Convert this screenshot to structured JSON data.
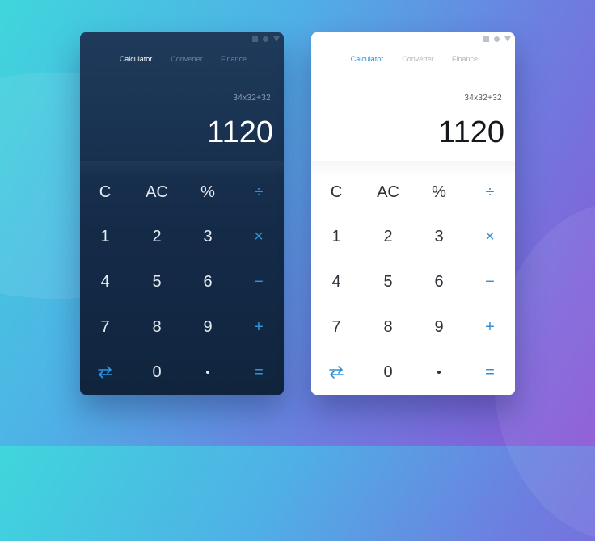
{
  "windows": [
    {
      "theme": "dark",
      "tabs": [
        {
          "label": "Calculator",
          "active": true
        },
        {
          "label": "Converter",
          "active": false
        },
        {
          "label": "Finance",
          "active": false
        }
      ],
      "display": {
        "expression": "34x32+32",
        "result": "1120"
      }
    },
    {
      "theme": "light",
      "tabs": [
        {
          "label": "Calculator",
          "active": true
        },
        {
          "label": "Converter",
          "active": false
        },
        {
          "label": "Finance",
          "active": false
        }
      ],
      "display": {
        "expression": "34x32+32",
        "result": "1120"
      }
    }
  ],
  "keys": {
    "clear": "C",
    "all_clear": "AC",
    "percent": "%",
    "divide": "÷",
    "one": "1",
    "two": "2",
    "three": "3",
    "multiply": "×",
    "four": "4",
    "five": "5",
    "six": "6",
    "minus": "−",
    "seven": "7",
    "eight": "8",
    "nine": "9",
    "plus": "+",
    "swap_icon": "swap-arrows-icon",
    "zero": "0",
    "decimal_icon": "decimal-point-icon",
    "equals": "="
  },
  "colors": {
    "dark_window_bg": "#1a3352",
    "light_window_bg": "#ffffff",
    "operator_accent": "#2f8fd6",
    "clear_red": "#e9574b"
  }
}
